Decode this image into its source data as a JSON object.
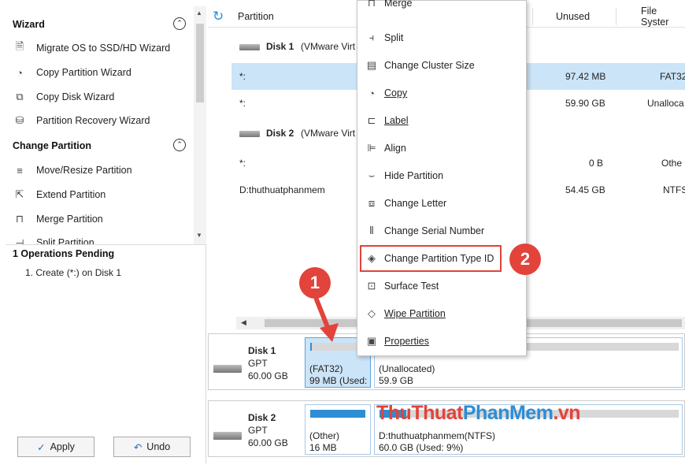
{
  "left": {
    "wizard_title": "Wizard",
    "wizard_items": [
      {
        "icon": "migrate-os-icon",
        "label": "Migrate OS to SSD/HD Wizard"
      },
      {
        "icon": "copy-partition-icon",
        "label": "Copy Partition Wizard"
      },
      {
        "icon": "copy-disk-icon",
        "label": "Copy Disk Wizard"
      },
      {
        "icon": "partition-recovery-icon",
        "label": "Partition Recovery Wizard"
      }
    ],
    "change_title": "Change Partition",
    "change_items": [
      {
        "icon": "move-resize-icon",
        "label": "Move/Resize Partition"
      },
      {
        "icon": "extend-icon",
        "label": "Extend Partition"
      },
      {
        "icon": "merge-icon",
        "label": "Merge Partition"
      },
      {
        "icon": "split-icon",
        "label": "Split Partition"
      }
    ],
    "pending_title": "1 Operations Pending",
    "pending_item": "1. Create (*:) on Disk 1",
    "apply_label": "Apply",
    "undo_label": "Undo"
  },
  "table": {
    "col_partition": "Partition",
    "col_unused": "Unused",
    "col_fs": "File Syster",
    "disk1_label": "Disk 1",
    "disk1_desc": "(VMware Virt",
    "disk2_label": "Disk 2",
    "disk2_desc": "(VMware Virt",
    "rows": [
      {
        "partition": "*:",
        "unused": "97.42 MB",
        "fs": "FAT32"
      },
      {
        "partition": "*:",
        "unused": "59.90 GB",
        "fs": "Unalloca"
      },
      {
        "partition": "*:",
        "unused": "0 B",
        "fs": "Othe"
      },
      {
        "partition": "D:thuthuatphanmem",
        "unused": "54.45 GB",
        "fs": "NTFS"
      }
    ]
  },
  "diskmap": {
    "disk1": {
      "name": "Disk 1",
      "type": "GPT",
      "size": "60.00 GB"
    },
    "disk1_p1": {
      "line1": "(FAT32)",
      "line2": "99 MB (Used:"
    },
    "disk1_p2": {
      "line1": "(Unallocated)",
      "line2": "59.9 GB"
    },
    "disk2": {
      "name": "Disk 2",
      "type": "GPT",
      "size": "60.00 GB"
    },
    "disk2_p1": {
      "line1": "(Other)",
      "line2": "16 MB"
    },
    "disk2_p2": {
      "line1": "D:thuthuatphanmem(NTFS)",
      "line2": "60.0 GB (Used: 9%)"
    },
    "disk2_p2_used": 0.09
  },
  "context_menu": {
    "items": [
      {
        "icon": "merge-icon",
        "label": "Merge"
      },
      {
        "icon": "split-icon",
        "label": "Split"
      },
      {
        "icon": "cluster-size-icon",
        "label": "Change Cluster Size"
      },
      {
        "icon": "copy-icon",
        "label": "Copy"
      },
      {
        "icon": "label-icon",
        "label": "Label"
      },
      {
        "icon": "align-icon",
        "label": "Align"
      },
      {
        "icon": "hide-icon",
        "label": "Hide Partition"
      },
      {
        "icon": "letter-icon",
        "label": "Change Letter"
      },
      {
        "icon": "serial-number-icon",
        "label": "Change Serial Number"
      },
      {
        "icon": "type-id-icon",
        "label": "Change Partition Type ID"
      },
      {
        "icon": "surface-test-icon",
        "label": "Surface Test"
      },
      {
        "icon": "wipe-icon",
        "label": "Wipe Partition"
      },
      {
        "icon": "properties-icon",
        "label": "Properties"
      }
    ]
  },
  "annotations": {
    "step1": "1",
    "step2": "2"
  },
  "watermark": {
    "part1": "ThuThuat",
    "part2": "PhanMem",
    "part3": ".vn"
  },
  "colors": {
    "accent": "#2d8dd5",
    "selection": "#cce4f7",
    "badge": "#e2433a"
  }
}
